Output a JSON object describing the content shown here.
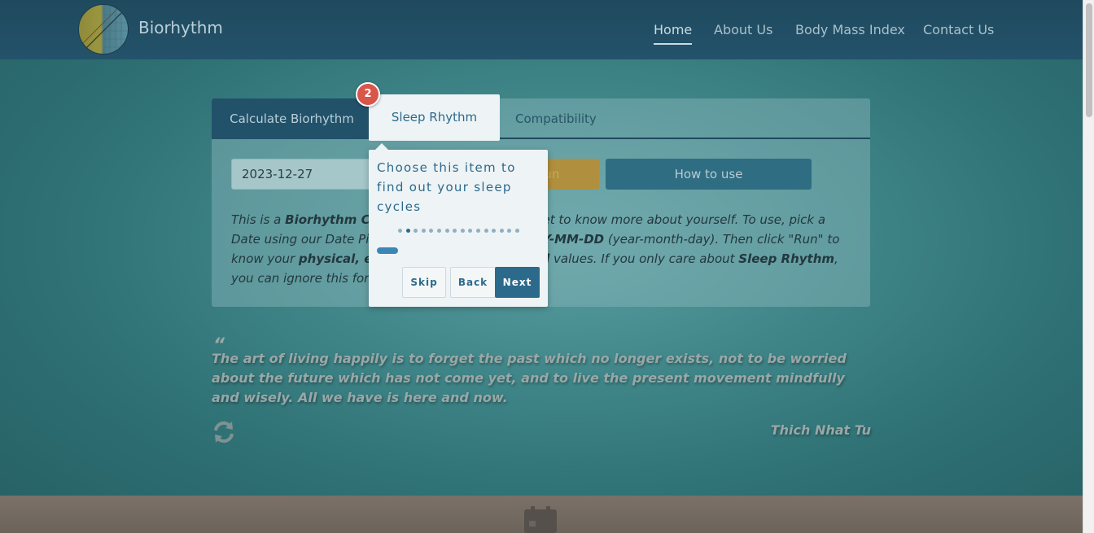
{
  "header": {
    "brand": "Biorhythm",
    "nav": [
      {
        "label": "Home",
        "active": true
      },
      {
        "label": "About Us"
      },
      {
        "label": "Body Mass Index"
      },
      {
        "label": "Contact Us"
      }
    ]
  },
  "tabs": [
    {
      "label": "Calculate Biorhythm",
      "active": true
    },
    {
      "label": "Sleep Rhythm"
    },
    {
      "label": "Compatibility"
    }
  ],
  "form": {
    "date_value": "2023-12-27",
    "run_label": "Run",
    "how_to_use_label": "How to use"
  },
  "description": {
    "p1": "This is a ",
    "b1": "Biorhythm Calculator",
    "p2": ". Use this tool to get to know more about yourself. To use, pick a Date using our Date Picker, the date format is ",
    "b2": "YYYY-MM-DD",
    "p3": " (year-month-day). Then click \"Run\" to know your ",
    "b3": "physical, emotional, and intellectual",
    "p4": " values. If you only care about ",
    "b4": "Sleep Rhythm",
    "p5": ", you can ignore this form."
  },
  "quote": {
    "mark": "“",
    "text": "The art of living happily is to forget the past which no longer exists, not to be worried about the future which has not come yet, and to live the present movement mindfully and wisely. All we have is here and now.",
    "author": "Thich Nhat Tu"
  },
  "tour": {
    "step_number": "2",
    "highlight_label": "Sleep Rhythm",
    "text": "Choose this item to find out your sleep cycles",
    "total_steps": 16,
    "current_step": 2,
    "progress": 0.13,
    "skip_label": "Skip",
    "back_label": "Back",
    "next_label": "Next"
  },
  "colors": {
    "accent": "#2c6a8c",
    "badge": "#d9564a",
    "run_button": "#b08f3e"
  },
  "icons": [
    "logo-icon",
    "refresh-icon",
    "calendar-icon"
  ]
}
